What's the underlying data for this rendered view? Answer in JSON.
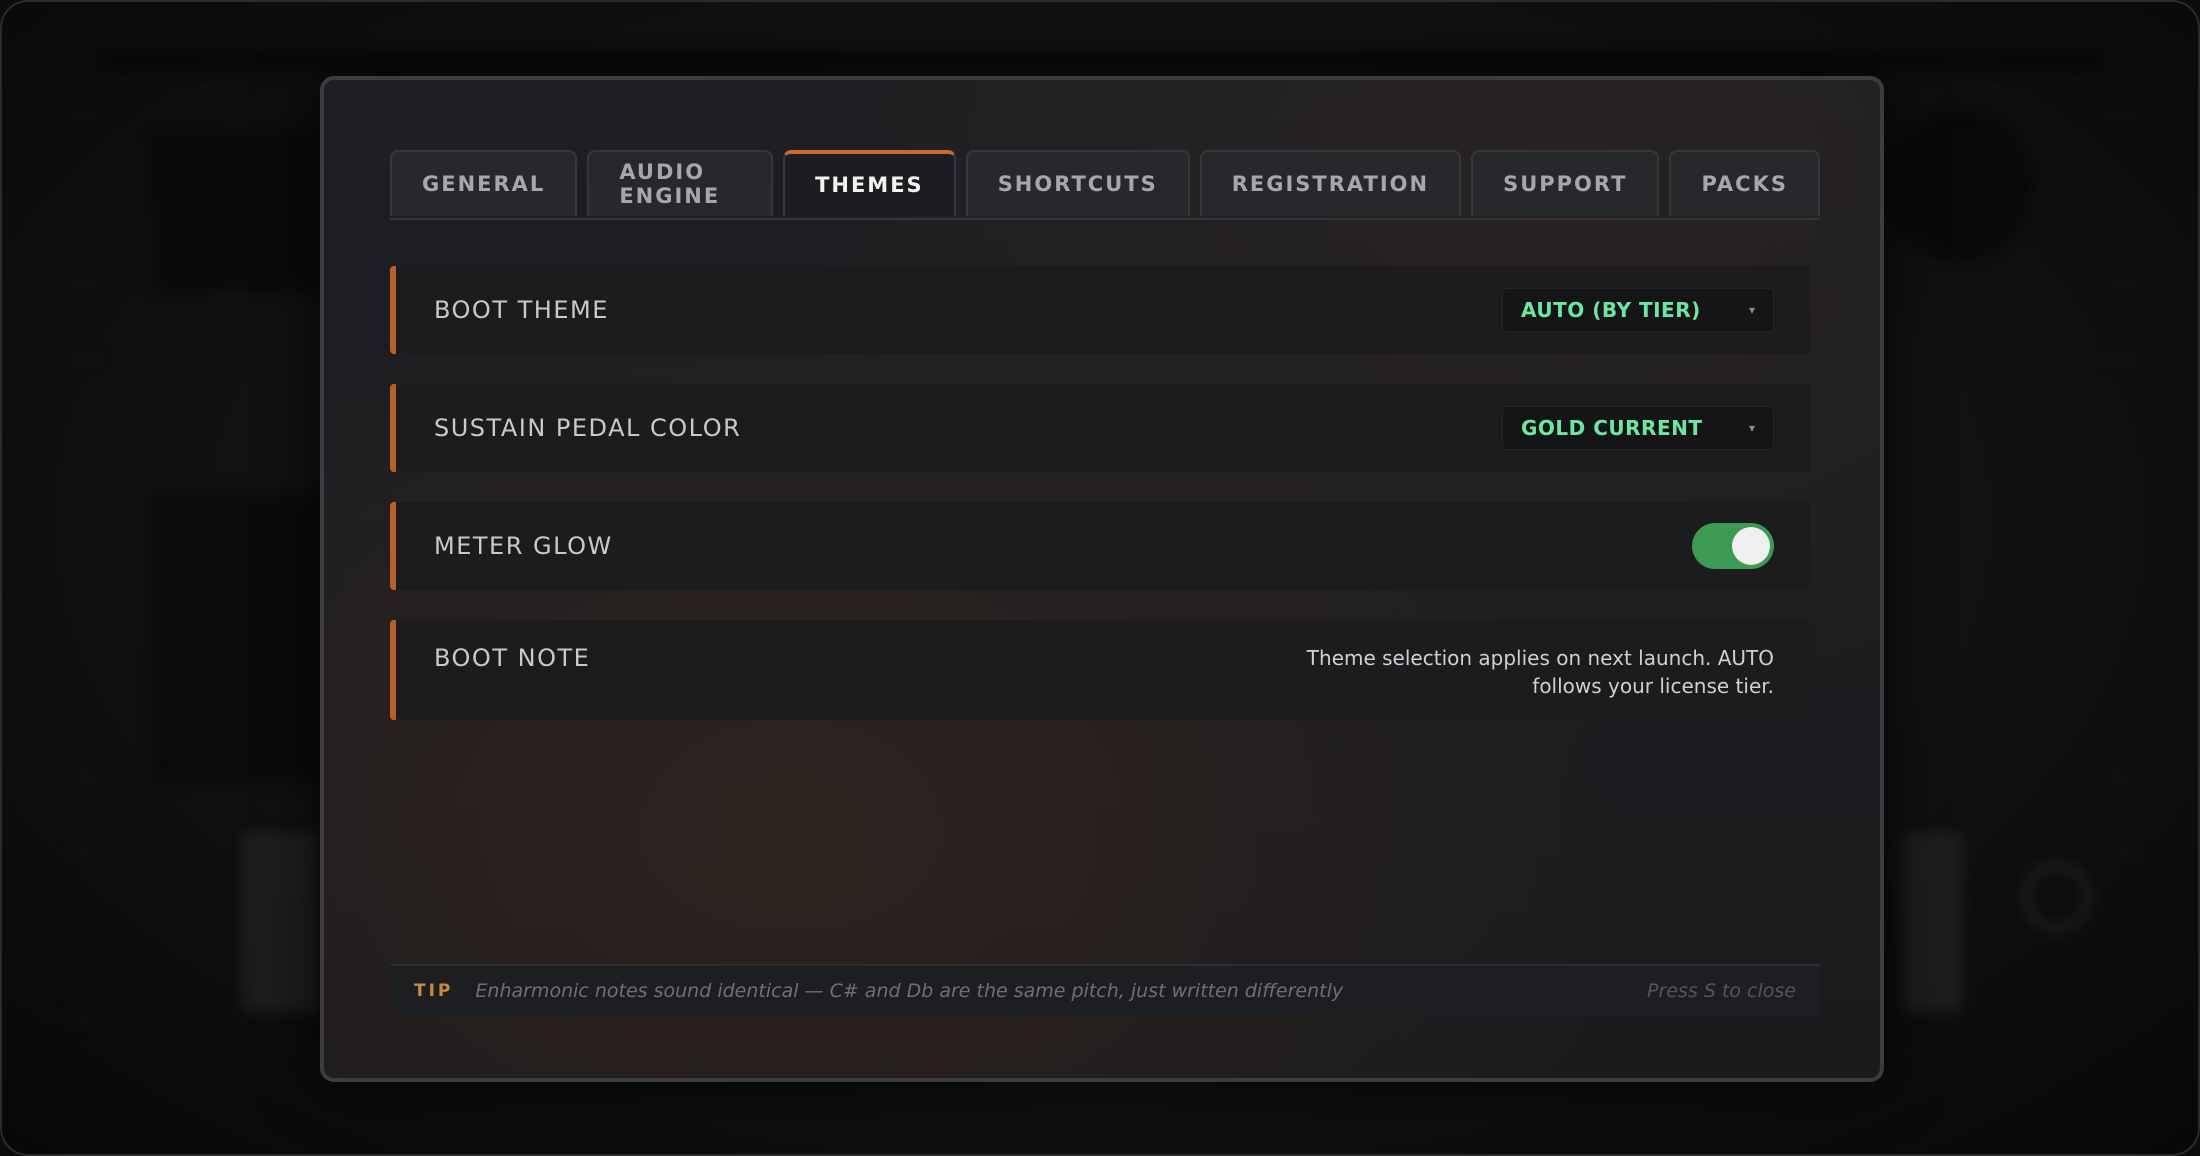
{
  "tabs": [
    {
      "label": "GENERAL"
    },
    {
      "label": "AUDIO ENGINE"
    },
    {
      "label": "THEMES"
    },
    {
      "label": "SHORTCUTS"
    },
    {
      "label": "REGISTRATION"
    },
    {
      "label": "SUPPORT"
    },
    {
      "label": "PACKS"
    }
  ],
  "active_tab": "THEMES",
  "settings": {
    "boot_theme": {
      "label": "BOOT THEME",
      "value": "AUTO (BY TIER)"
    },
    "sustain_pedal_color": {
      "label": "SUSTAIN PEDAL COLOR",
      "value": "GOLD CURRENT"
    },
    "meter_glow": {
      "label": "METER GLOW",
      "enabled": true
    },
    "boot_note": {
      "label": "BOOT NOTE",
      "line1": "Theme selection applies on next launch. AUTO",
      "line2": "follows your license tier."
    }
  },
  "tip": {
    "label": "TIP",
    "text": "Enharmonic notes sound identical — C# and Db are the same pitch, just written differently",
    "close_hint": "Press S to close"
  },
  "colors": {
    "accent": "#c9692e",
    "value_green": "#6de6a4",
    "toggle_on": "#3d9a52"
  },
  "icons": {
    "dropdown_caret": "▾"
  }
}
